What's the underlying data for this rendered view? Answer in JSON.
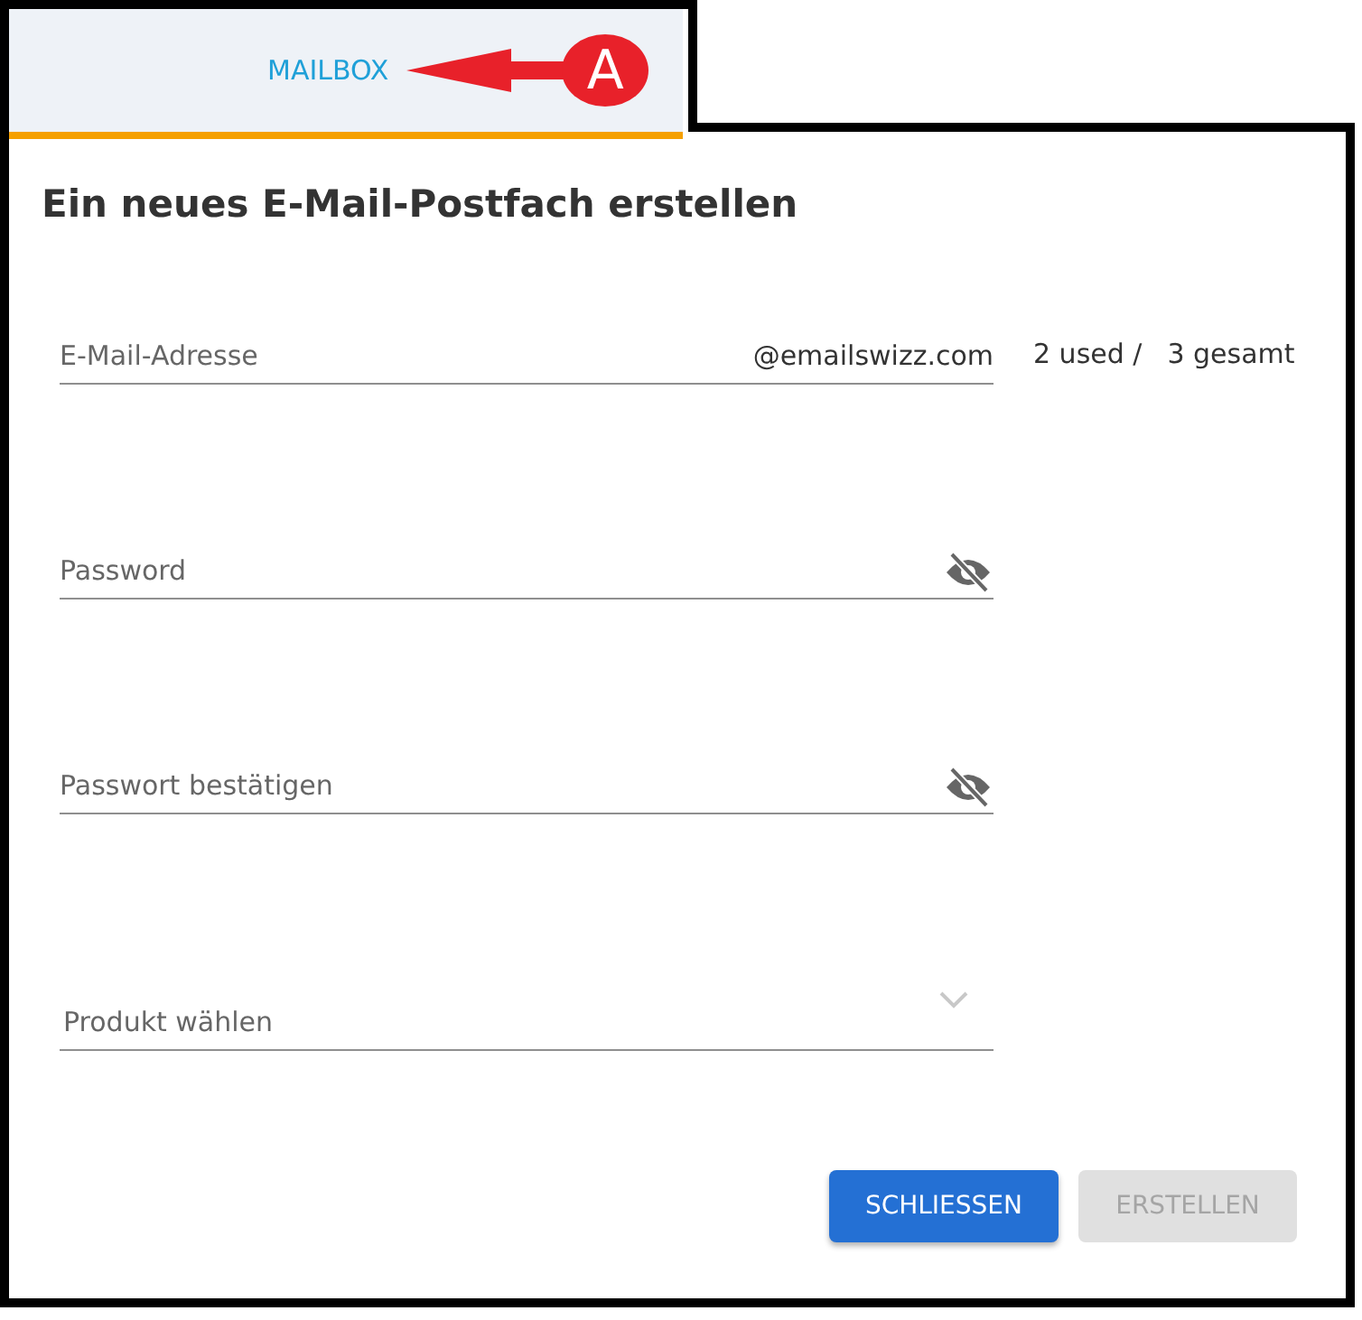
{
  "tab": {
    "label": "MAILBOX",
    "selected": true
  },
  "callout": {
    "label": "A"
  },
  "dialog": {
    "title": "Ein neues E-Mail-Postfach erstellen",
    "fields": [
      {
        "kind": "email",
        "placeholder": "E-Mail-Adresse",
        "suffix": "@emailswizz.com",
        "used": "2 used /",
        "total": "3 gesamt"
      },
      {
        "kind": "password",
        "placeholder": "Password"
      },
      {
        "kind": "password",
        "placeholder": "Passwort bestätigen"
      },
      {
        "kind": "select",
        "placeholder": "Produkt wählen"
      }
    ],
    "buttons": [
      {
        "label": "SCHLIESSEN",
        "disabled": false
      },
      {
        "label": "ERSTELLEN",
        "disabled": true
      }
    ]
  }
}
